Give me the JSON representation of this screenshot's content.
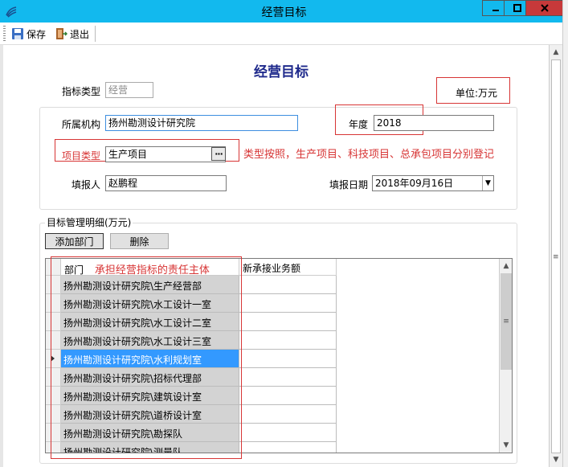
{
  "window": {
    "title": "经营目标"
  },
  "toolbar": {
    "save_label": "保存",
    "exit_label": "退出"
  },
  "form": {
    "heading": "经营目标",
    "unit_label": "单位:万元",
    "indicator_type_label": "指标类型",
    "indicator_type_value": "经营",
    "org_label": "所属机构",
    "org_value": "扬州勘测设计研究院",
    "year_label": "年度",
    "year_value": "2018",
    "project_type_label": "项目类型",
    "project_type_value": "生产项目",
    "project_type_annotation": "类型按照，生产项目、科技项目、总承包项目分别登记",
    "reporter_label": "填报人",
    "reporter_value": "赵鹏程",
    "report_date_label": "填报日期",
    "report_date_value": "2018年09月16日"
  },
  "detail": {
    "group_title": "目标管理明细(万元)",
    "add_dept_label": "添加部门",
    "delete_label": "删除",
    "col_dept": "部门",
    "dept_annotation": "承担经营指标的责任主体",
    "col_amount": "新承接业务额",
    "selected_row": 4,
    "rows": [
      {
        "dept": "扬州勘测设计研究院\\生产经营部",
        "amount": ""
      },
      {
        "dept": "扬州勘测设计研究院\\水工设计一室",
        "amount": ""
      },
      {
        "dept": "扬州勘测设计研究院\\水工设计二室",
        "amount": ""
      },
      {
        "dept": "扬州勘测设计研究院\\水工设计三室",
        "amount": ""
      },
      {
        "dept": "扬州勘测设计研究院\\水利规划室",
        "amount": ""
      },
      {
        "dept": "扬州勘测设计研究院\\招标代理部",
        "amount": ""
      },
      {
        "dept": "扬州勘测设计研究院\\建筑设计室",
        "amount": ""
      },
      {
        "dept": "扬州勘测设计研究院\\道桥设计室",
        "amount": ""
      },
      {
        "dept": "扬州勘测设计研究院\\勘探队",
        "amount": ""
      },
      {
        "dept": "扬州勘测设计研究院\\测量队",
        "amount": ""
      }
    ]
  },
  "colors": {
    "titlebar": "#12b9ee",
    "heading": "#1f2a8c",
    "annotation": "#d73535",
    "selection": "#3399ff"
  }
}
